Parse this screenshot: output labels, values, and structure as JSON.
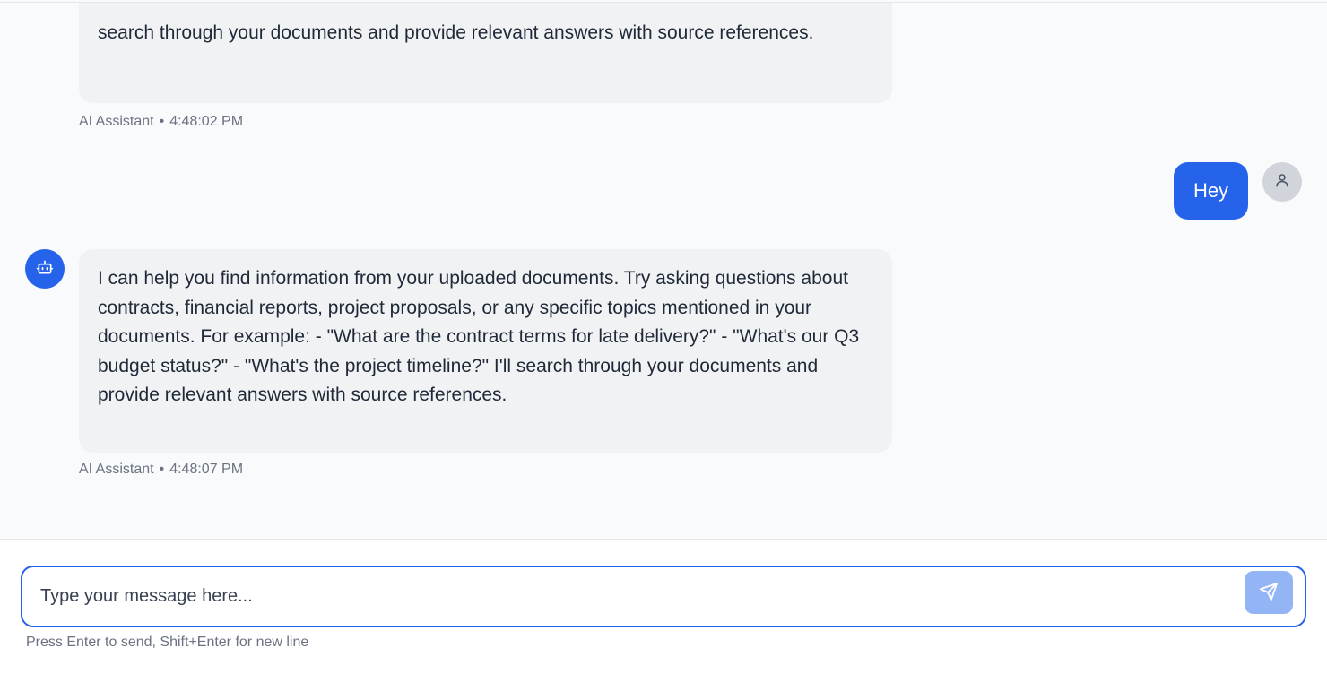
{
  "messages": [
    {
      "role": "bot",
      "text": "I can help you find information from your uploaded documents. Try asking questions about contracts, financial reports, project proposals, or any specific topics mentioned in your documents. For example: - \"What are the contract terms for late delivery?\" - \"What's our Q3 budget status?\" - \"What's the project timeline?\" I'll search through your documents and provide relevant answers with source references.",
      "partial_text": "search through your documents and provide relevant answers with source references.",
      "sender": "AI Assistant",
      "time": "4:48:02 PM"
    },
    {
      "role": "user",
      "text": "Hey"
    },
    {
      "role": "bot",
      "text": "I can help you find information from your uploaded documents. Try asking questions about contracts, financial reports, project proposals, or any specific topics mentioned in your documents. For example: - \"What are the contract terms for late delivery?\" - \"What's our Q3 budget status?\" - \"What's the project timeline?\" I'll search through your documents and provide relevant answers with source references.",
      "sender": "AI Assistant",
      "time": "4:48:07 PM"
    }
  ],
  "meta_separator": "•",
  "composer": {
    "placeholder": "Type your message here...",
    "value": "",
    "hint": "Press Enter to send, Shift+Enter for new line",
    "send_icon": "send-icon"
  },
  "icons": {
    "bot_avatar": "robot-icon",
    "user_avatar": "user-icon"
  },
  "colors": {
    "accent": "#2563eb",
    "bot_bubble": "#f1f2f4",
    "send_disabled": "#93b4f5",
    "background": "#f8fafc"
  }
}
